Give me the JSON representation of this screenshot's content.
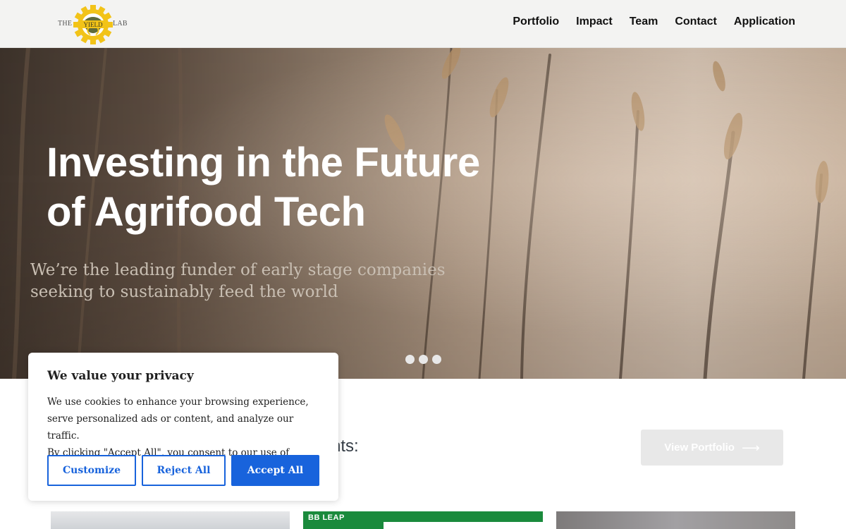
{
  "brand": {
    "logo_left_word": "THE",
    "logo_center_word": "YIELD",
    "logo_right_word": "LAB",
    "gear_color": "#f2c318",
    "badge_color": "#5f6b3a"
  },
  "nav": {
    "items": [
      {
        "label": "Portfolio"
      },
      {
        "label": "Impact"
      },
      {
        "label": "Team"
      },
      {
        "label": "Contact"
      },
      {
        "label": "Application"
      }
    ]
  },
  "hero": {
    "title_line1": "Investing in the Future",
    "title_line2": "of Agrifood Tech",
    "subtitle_line1": "We’re the leading funder of early stage companies",
    "subtitle_line2": "seeking to sustainably feed the world",
    "slider_dot_count": 3
  },
  "portfolio_section": {
    "heading_visible_fragment": "nts:",
    "view_button_label": "View Portfolio",
    "view_button_icon": "arrow-right-icon"
  },
  "cards": [
    {
      "kind": "photo"
    },
    {
      "kind": "logo",
      "brand_text": "BB LEAP"
    },
    {
      "kind": "photo"
    }
  ],
  "cookie_banner": {
    "title": "We value your privacy",
    "body_line1": "We use cookies to enhance your browsing experience,",
    "body_line2": "serve personalized ads or content, and analyze our traffic.",
    "body_line3": "By clicking \"Accept All\", you consent to our use of cookies.",
    "customize_label": "Customize",
    "reject_label": "Reject All",
    "accept_label": "Accept All",
    "accent_color": "#1863dc"
  }
}
